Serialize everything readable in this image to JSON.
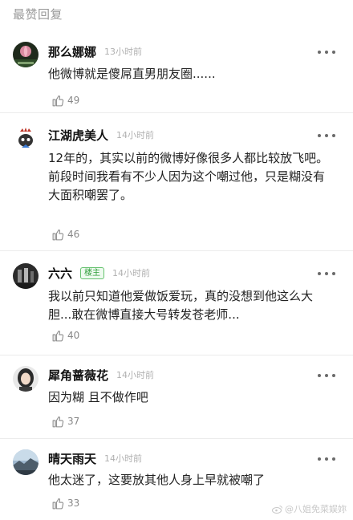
{
  "section": {
    "title": "最赞回复"
  },
  "comments": [
    {
      "username": "那么娜娜",
      "badge": "",
      "time": "13小时前",
      "lines": [
        "他微博就是傻屌直男朋友圈......"
      ],
      "likes": "49",
      "avatar_icon": "lotus-avatar-icon"
    },
    {
      "username": "江湖虎美人",
      "badge": "",
      "time": "14小时前",
      "lines": [
        "12年的，其实以前的微博好像很多人都比较放飞吧。",
        "前段时间我看有不少人因为这个嘲过他，只是糊没有大面积嘲罢了。"
      ],
      "likes": "46",
      "avatar_icon": "crowned-cat-avatar-icon"
    },
    {
      "username": "六六",
      "badge": "楼主",
      "time": "14小时前",
      "lines": [
        "我以前只知道他爱做饭爱玩，真的没想到他这么大胆...敢在微博直接大号转发苍老师..."
      ],
      "likes": "40",
      "avatar_icon": "dark-photo-avatar-icon"
    },
    {
      "username": "犀角蔷薇花",
      "badge": "",
      "time": "14小时前",
      "lines": [
        "因为糊  且不做作吧"
      ],
      "likes": "37",
      "avatar_icon": "portrait-avatar-icon"
    },
    {
      "username": "晴天雨天",
      "badge": "",
      "time": "14小时前",
      "lines": [
        "他太迷了，这要放其他人身上早就被嘲了"
      ],
      "likes": "33",
      "avatar_icon": "landscape-avatar-icon"
    }
  ],
  "watermark": {
    "text": "@八姐免菜娱妳"
  },
  "colors": {
    "accent_green": "#2f9e3a",
    "muted_gray": "#999999",
    "divider": "#ececec"
  }
}
